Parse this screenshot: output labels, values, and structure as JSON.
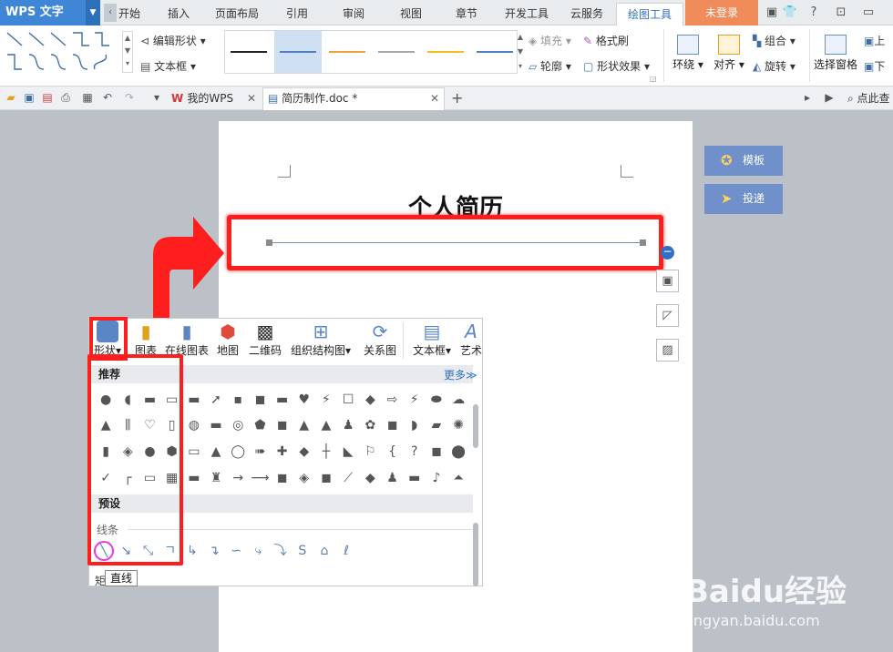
{
  "app": {
    "name": "WPS 文字"
  },
  "menu": {
    "tabs": [
      "开始",
      "插入",
      "页面布局",
      "引用",
      "审阅",
      "视图",
      "章节",
      "开发工具",
      "云服务",
      "绘图工具"
    ],
    "active_tab": "绘图工具",
    "login": "未登录",
    "help": "?"
  },
  "ribbon": {
    "edit_shape": "编辑形状",
    "text_box": "文本框",
    "fill": "填充",
    "format_painter": "格式刷",
    "outline": "轮廓",
    "shape_effect": "形状效果",
    "wrap": "环绕",
    "align": "对齐",
    "group": "组合",
    "rotate": "旋转",
    "selection_pane": "选择窗格",
    "up": "上",
    "down": "下"
  },
  "doc_tabs": {
    "tab1": "我的WPS",
    "tab2": "简历制作.doc *",
    "search": "点此查"
  },
  "document": {
    "title": "个人简历"
  },
  "side": {
    "template": "模板",
    "deliver": "投递"
  },
  "panel": {
    "tools": [
      "形状",
      "图表",
      "在线图表",
      "地图",
      "二维码",
      "组织结构图",
      "关系图",
      "文本框",
      "艺术"
    ],
    "recommend": "推荐",
    "more": "更多≫",
    "preset": "预设",
    "lines": "线条",
    "tooltip": "直线",
    "below_tooltip": "矩"
  },
  "watermark": {
    "main": "Baidu经验",
    "sub": "jingyan.baidu.com"
  },
  "colors": {
    "accent": "#3f87d6",
    "highlight": "#ff1e1e",
    "login": "#f08b5a"
  }
}
